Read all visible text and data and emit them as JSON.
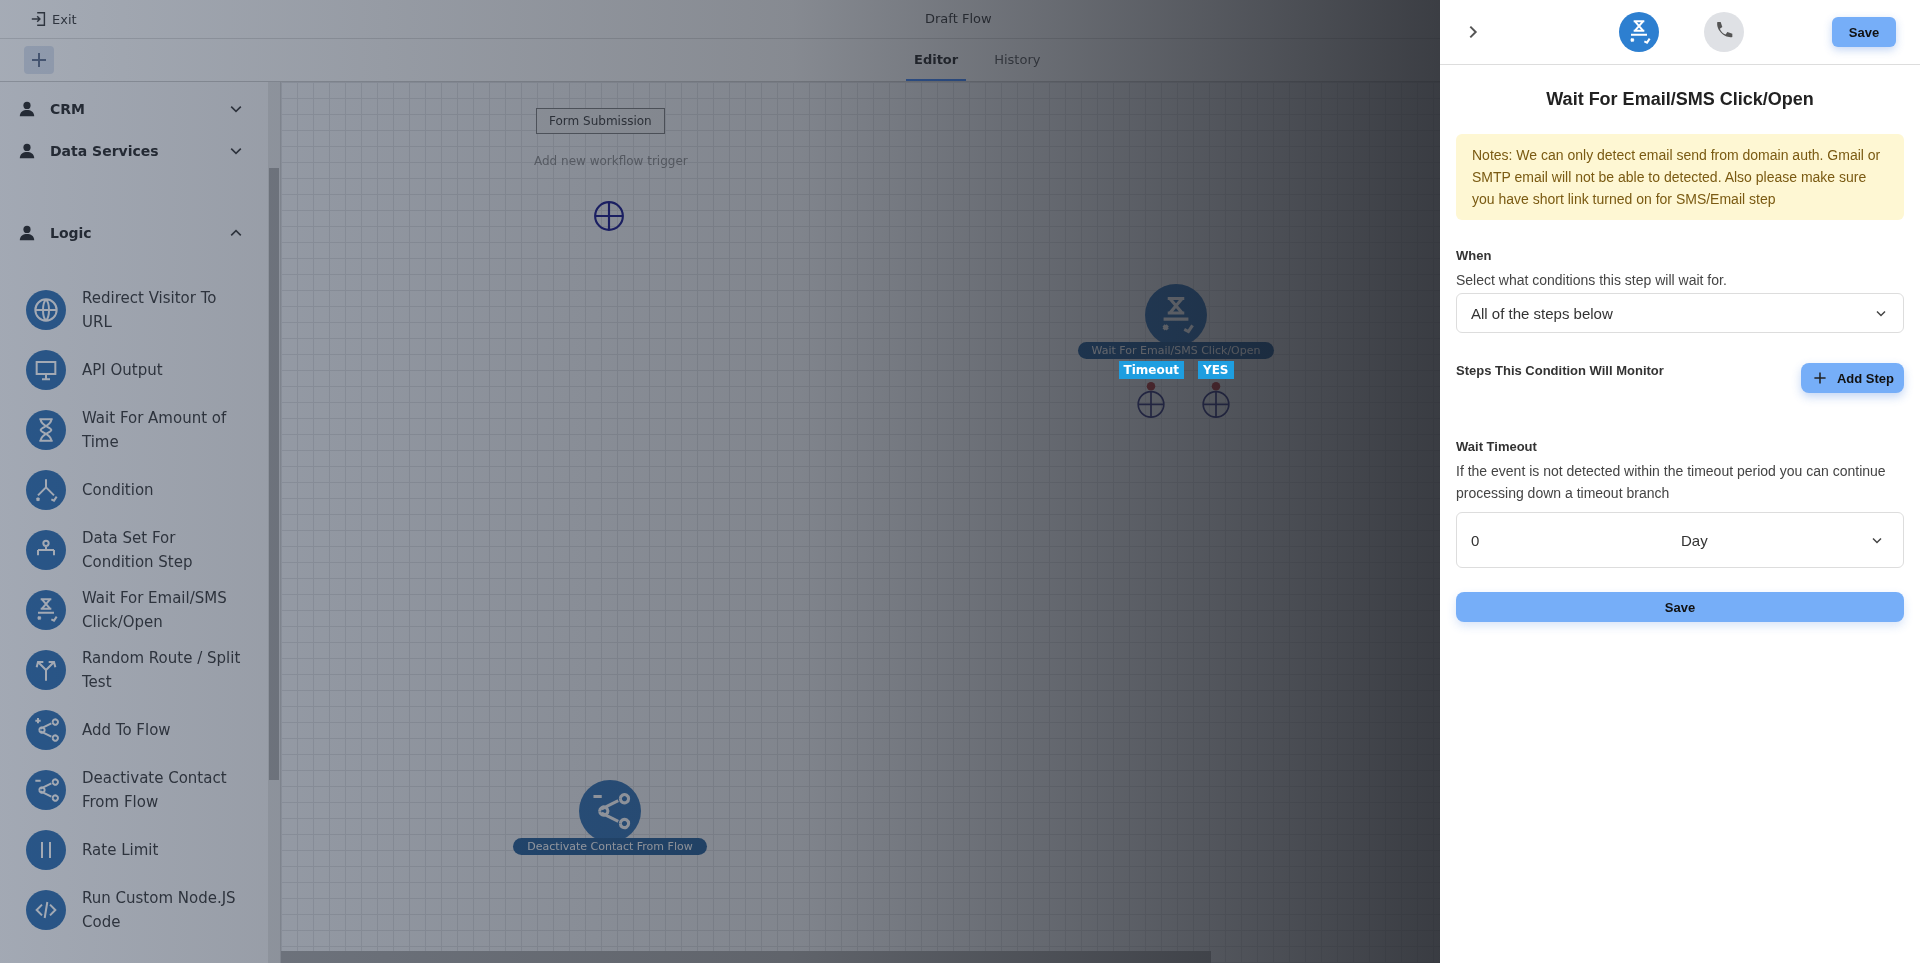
{
  "top_bar": {
    "exit": "Exit",
    "title": "Draft Flow"
  },
  "tabs": [
    {
      "label": "Editor",
      "selected": true
    },
    {
      "label": "History",
      "selected": false
    }
  ],
  "sidebar": {
    "categories": [
      {
        "label": "CRM",
        "expanded": false
      },
      {
        "label": "Data Services",
        "expanded": false
      },
      {
        "label": "Logic",
        "expanded": true,
        "items": [
          "Redirect Visitor To URL",
          "API Output",
          "Wait For Amount of Time",
          "Condition",
          "Data Set For Condition Step",
          "Wait For Email/SMS Click/Open",
          "Random Route / Split Test",
          "Add To Flow",
          "Deactivate Contact From Flow",
          "Rate Limit",
          "Run Custom Node.JS Code"
        ]
      }
    ]
  },
  "canvas": {
    "trigger": {
      "label": "Form Submission",
      "hint": "Add new workflow trigger"
    },
    "nodes": [
      {
        "kind": "wait",
        "label": "Wait For Email/SMS Click/Open",
        "branches": [
          "Timeout",
          "YES"
        ]
      },
      {
        "kind": "share",
        "label": "Deactivate Contact From Flow"
      }
    ]
  },
  "panel": {
    "save": "Save",
    "title": "Wait For Email/SMS Click/Open",
    "note": "Notes: We can only detect email send from domain auth. Gmail or SMTP email will not be able to detected. Also please make sure you have short link turned on for SMS/Email step",
    "when_label": "When",
    "when_help": "Select what conditions this step will wait for.",
    "when_value": "All of the steps below",
    "steps_label": "Steps This Condition Will Monitor",
    "add_step": "Add Step",
    "timeout_label": "Wait Timeout",
    "timeout_help": "If the event is not detected within the timeout period you can continue processing down a timeout branch",
    "timeout_amount": "0",
    "timeout_unit": "Day",
    "save_bottom": "Save"
  }
}
